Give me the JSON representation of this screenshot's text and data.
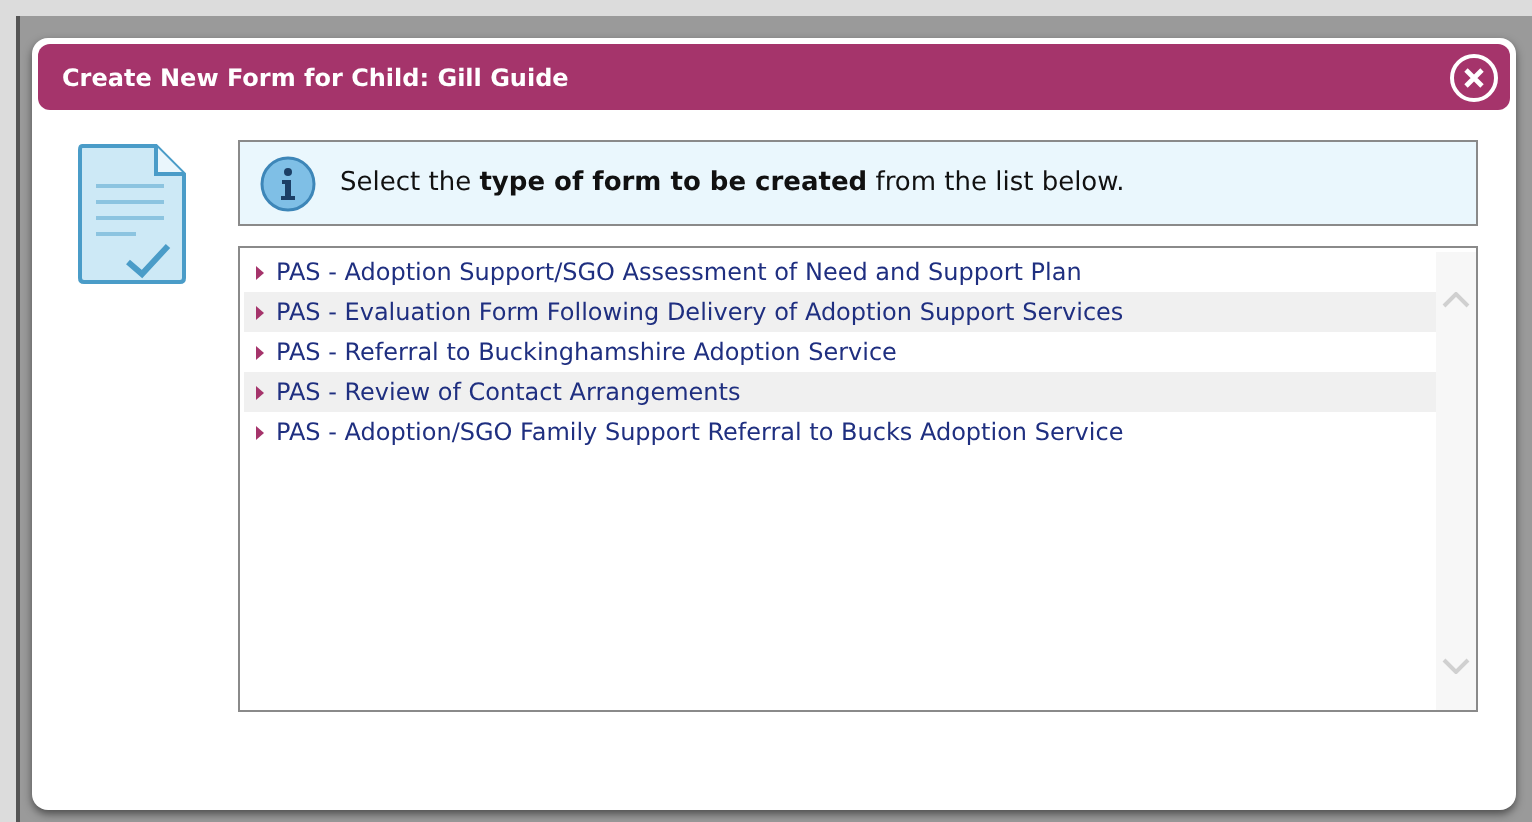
{
  "dialog": {
    "title": "Create New Form for Child: Gill Guide"
  },
  "instruction": "Select the **type of form to be created** from the list below.",
  "forms": [
    {
      "label": "PAS - Adoption Support/SGO Assessment of Need and Support Plan"
    },
    {
      "label": "PAS - Evaluation Form Following Delivery of Adoption Support Services"
    },
    {
      "label": "PAS - Referral to Buckinghamshire Adoption Service"
    },
    {
      "label": "PAS - Review of Contact Arrangements"
    },
    {
      "label": "PAS - Adoption/SGO Family Support Referral to Bucks Adoption Service"
    }
  ]
}
